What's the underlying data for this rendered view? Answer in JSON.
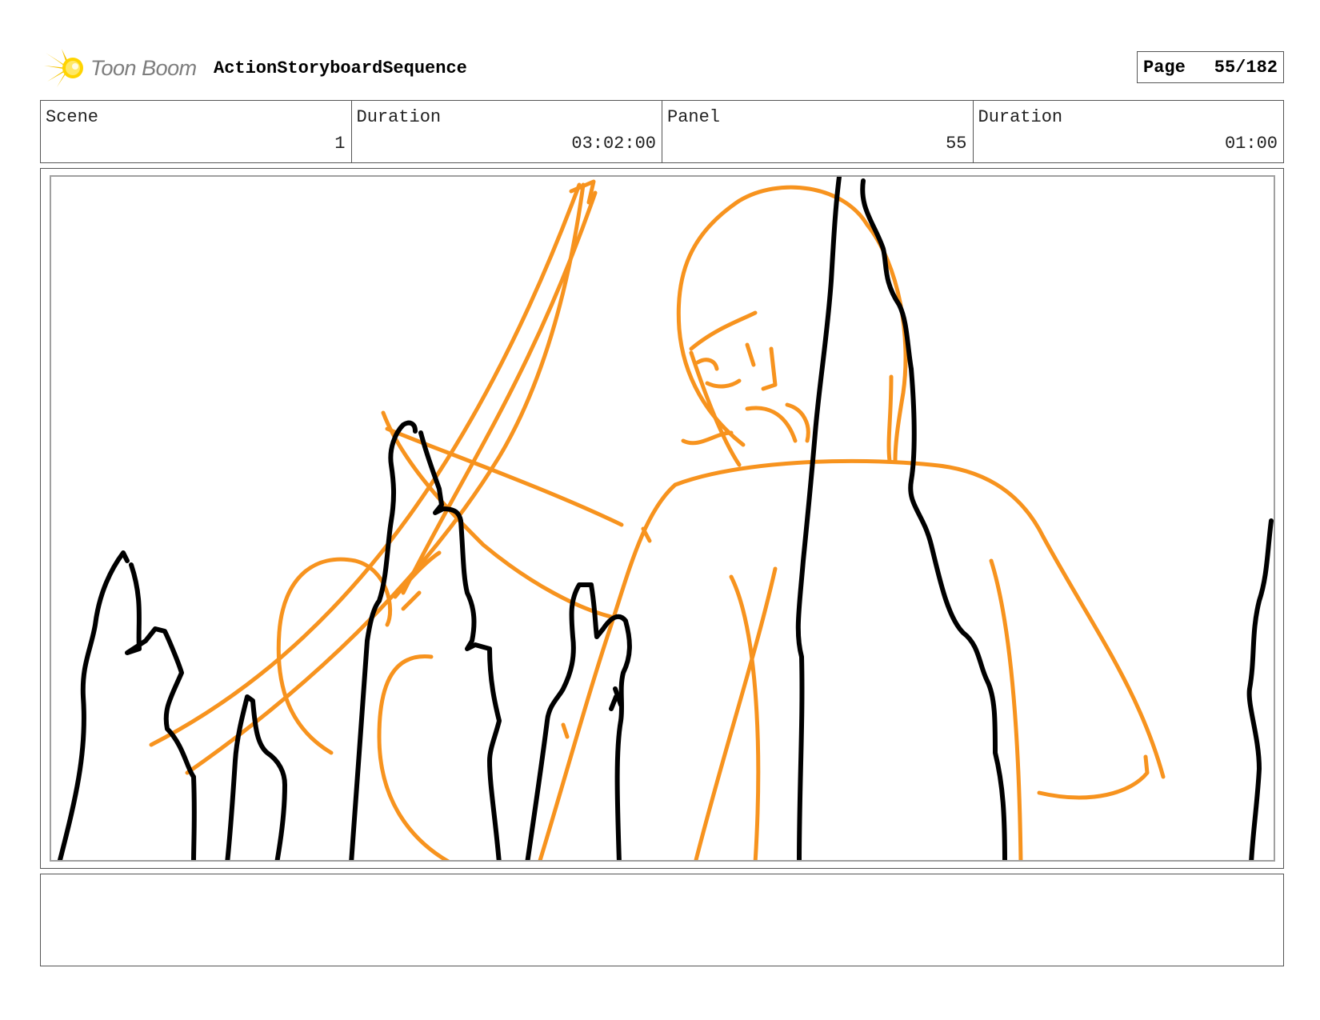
{
  "header": {
    "logo_text": "Toon Boom",
    "project_title": "ActionStoryboardSequence",
    "page_label": "Page",
    "page_value": "55/182"
  },
  "info": {
    "scene_label": "Scene",
    "scene_value": "1",
    "scene_duration_label": "Duration",
    "scene_duration_value": "03:02:00",
    "panel_label": "Panel",
    "panel_value": "55",
    "panel_duration_label": "Duration",
    "panel_duration_value": "01:00"
  },
  "colors": {
    "sketch_orange": "#f7931e",
    "ink_black": "#000000",
    "logo_yellow": "#f5c400",
    "frame_gray": "#a0a0a0"
  },
  "icons": {
    "logo": "toon-boom-starburst-icon"
  },
  "notes": {
    "text": ""
  }
}
